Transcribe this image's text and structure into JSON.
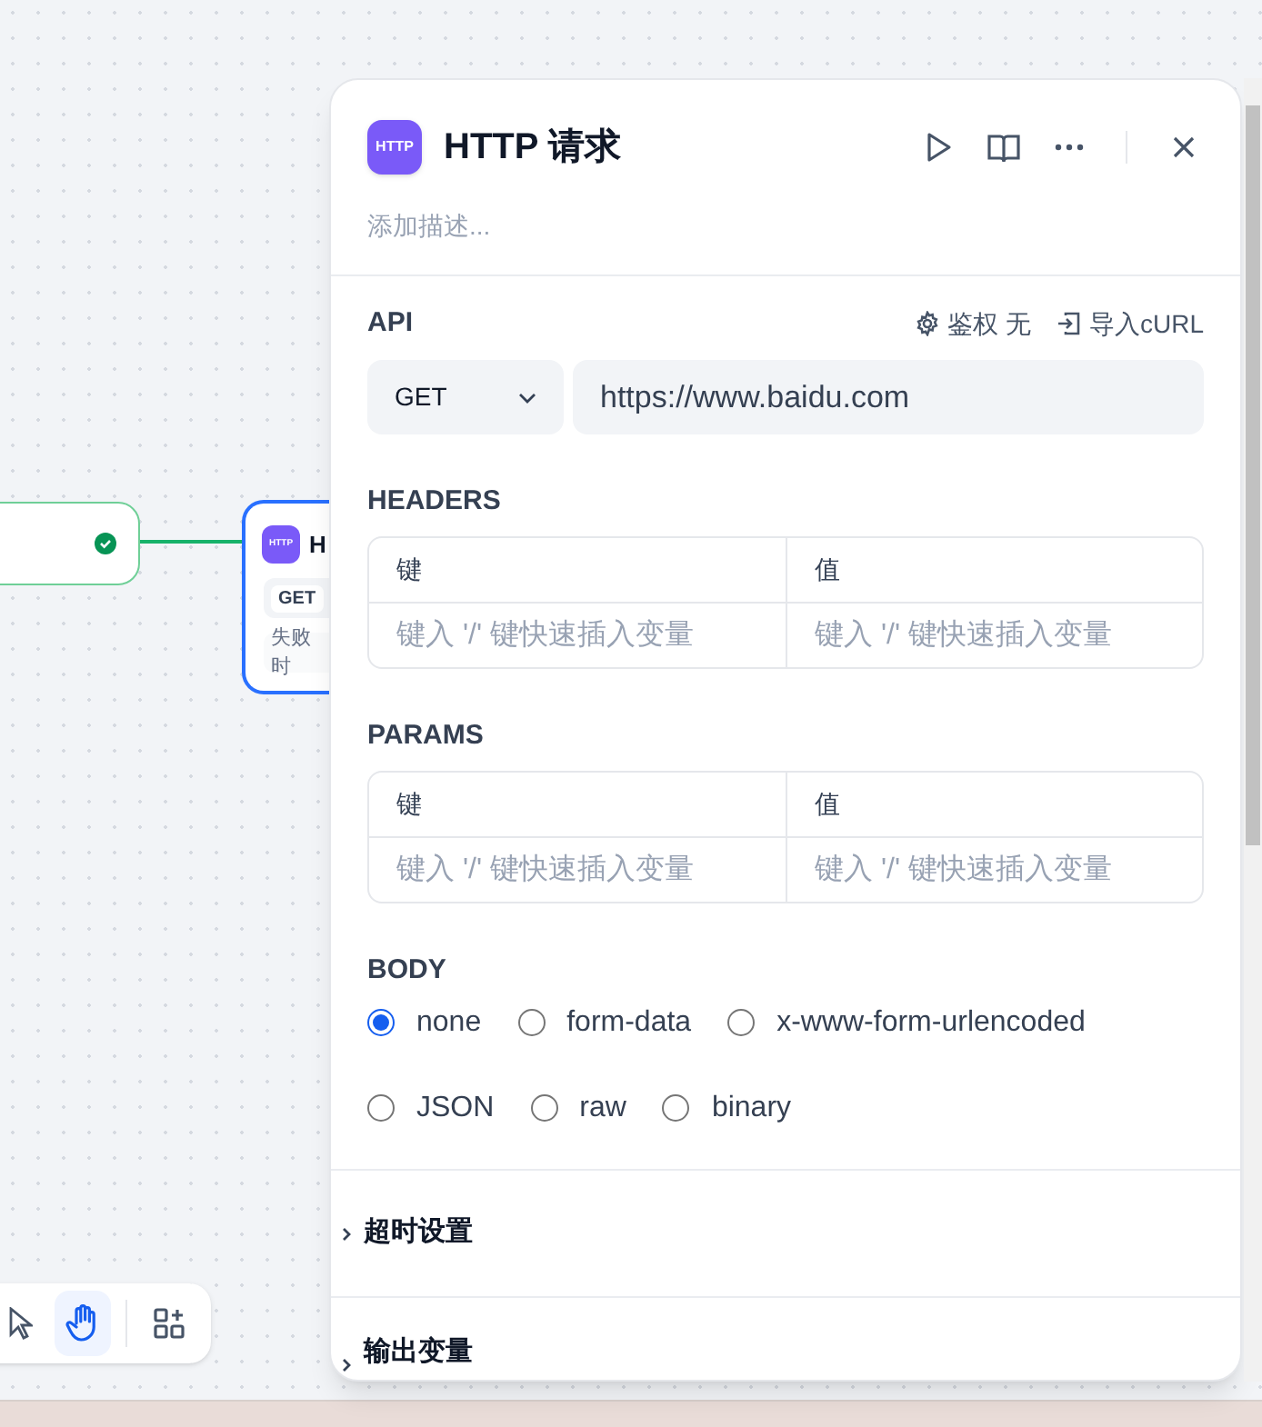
{
  "canvas": {
    "nodes": [
      {
        "kind": "source",
        "succeeded": true
      },
      {
        "kind": "http",
        "selected": true,
        "badge": "HTTP",
        "title": "H",
        "method": "GET",
        "note": "失败时"
      }
    ]
  },
  "toolbar": [
    {
      "kind": "pointer",
      "selected": false
    },
    {
      "kind": "hand",
      "selected": true
    },
    {
      "kind": "add",
      "selected": false
    }
  ],
  "panel": {
    "badge": "HTTP",
    "title": "HTTP 请求",
    "description_placeholder": "添加描述...",
    "api": {
      "label": "API",
      "auth_label": "鉴权",
      "auth_value": "无",
      "import": "导入cURL",
      "method": "GET",
      "url": "https://www.baidu.com"
    },
    "tables": [
      {
        "label": "HEADERS",
        "columns": [
          "键",
          "值"
        ],
        "rows": [
          {
            "key_placeholder": "键入 '/' 键快速插入变量",
            "value_placeholder": "键入 '/' 键快速插入变量"
          }
        ]
      },
      {
        "label": "PARAMS",
        "columns": [
          "键",
          "值"
        ],
        "rows": [
          {
            "key_placeholder": "键入 '/' 键快速插入变量",
            "value_placeholder": "键入 '/' 键快速插入变量"
          }
        ]
      }
    ],
    "body": {
      "label": "BODY",
      "options": [
        {
          "label": "none",
          "selected": true
        },
        {
          "label": "form-data",
          "selected": false
        },
        {
          "label": "x-www-form-urlencoded",
          "selected": false
        },
        {
          "label": "JSON",
          "selected": false
        },
        {
          "label": "raw",
          "selected": false
        },
        {
          "label": "binary",
          "selected": false
        }
      ]
    },
    "sections": [
      {
        "label": "超时设置",
        "expanded": false
      },
      {
        "label": "输出变量",
        "expanded": false
      }
    ]
  }
}
